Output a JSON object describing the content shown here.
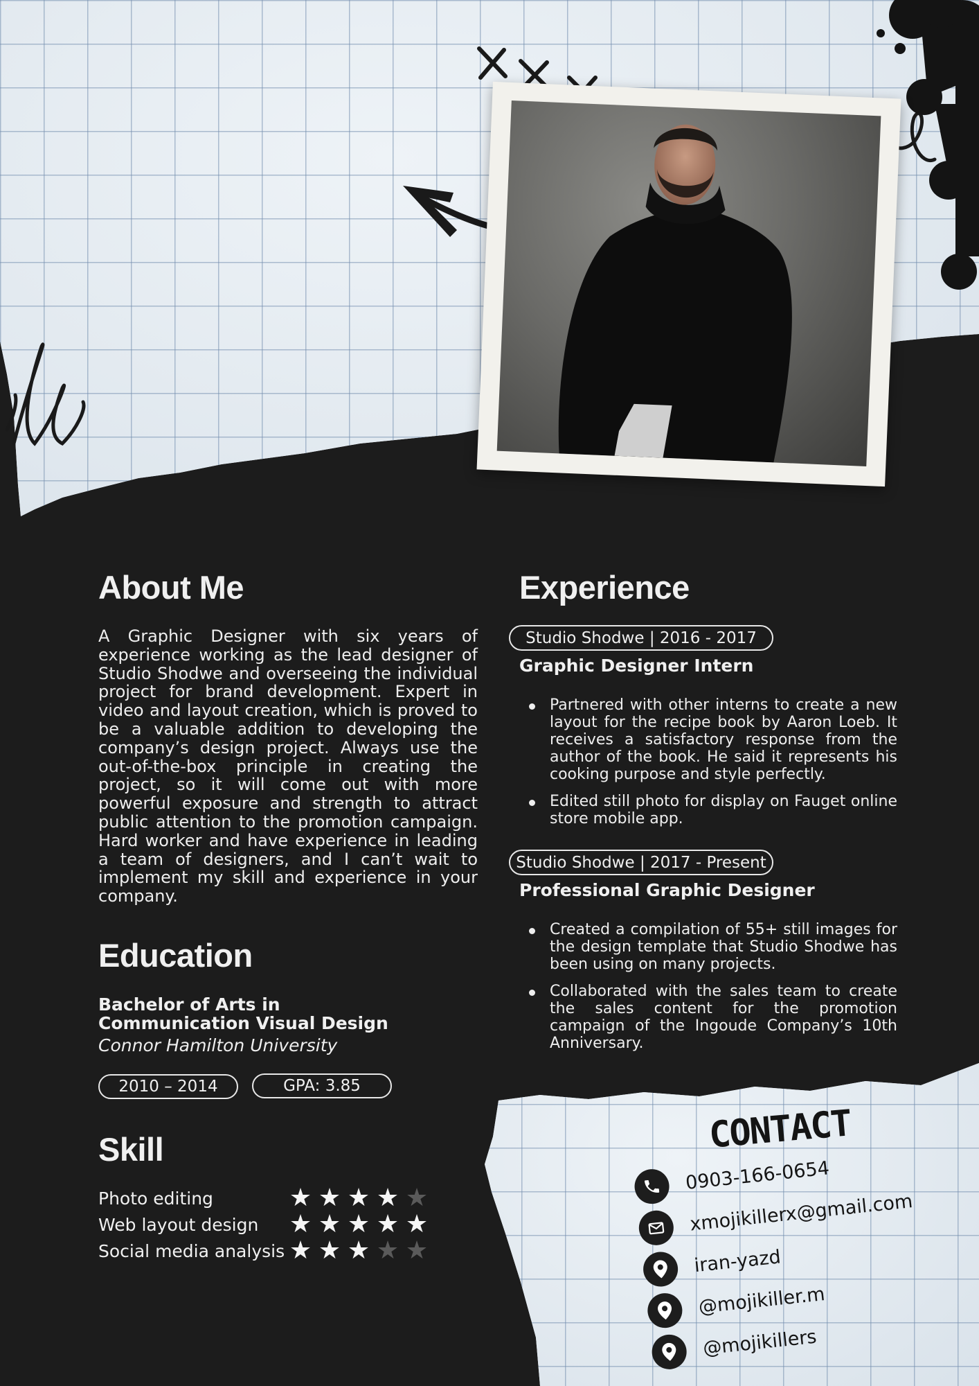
{
  "colors": {
    "background": "#1c1c1c",
    "paper": "#dfe7ee",
    "grid": "#748eae",
    "text_light": "#ededed",
    "text_dark": "#151515"
  },
  "about": {
    "heading": "About Me",
    "text": "A Graphic Designer with six years of experience working as the lead designer of Studio Shodwe and overseeing the individual project for brand development. Expert in video and layout creation, which is proved to be a valuable addition to developing the company’s design project. Always use the out-of-the-box principle in creating the project, so it will come out with more powerful exposure and strength to attract public attention to the promotion campaign. Hard worker and have experience in leading a team of designers, and I can’t wait to implement my skill and experience in your company."
  },
  "education": {
    "heading": "Education",
    "degree_line1": "Bachelor of Arts in",
    "degree_line2": "Communication Visual Design",
    "school": "Connor Hamilton University",
    "years": "2010 – 2014",
    "gpa": "GPA: 3.85"
  },
  "skills": {
    "heading": "Skill",
    "items": [
      {
        "name": "Photo editing",
        "rating": 4,
        "max": 5
      },
      {
        "name": "Web layout design",
        "rating": 5,
        "max": 5
      },
      {
        "name": "Social media analysis",
        "rating": 3,
        "max": 5
      }
    ]
  },
  "experience": {
    "heading": "Experience",
    "jobs": [
      {
        "period": "Studio Shodwe | 2016 - 2017",
        "title": "Graphic Designer Intern",
        "bullets": [
          "Partnered with other interns to create a new layout for the recipe book by Aaron Loeb. It receives a satisfactory response from the author of the book. He said it represents his cooking purpose and style perfectly.",
          "Edited still photo for display on Fauget online store mobile app."
        ]
      },
      {
        "period": "Studio Shodwe | 2017 - Present",
        "title": "Professional Graphic Designer",
        "bullets": [
          "Created a compilation of 55+ still images for the design template that Studio Shodwe has been using on many projects.",
          "Collaborated with the sales team to create the sales content for the promotion campaign of the Ingoude Company’s 10th Anniversary."
        ]
      }
    ]
  },
  "contact": {
    "heading": "CONTACT",
    "items": [
      {
        "icon": "phone-icon",
        "text": "0903-166-0654"
      },
      {
        "icon": "mail-icon",
        "text": "xmojikillerx@gmail.com"
      },
      {
        "icon": "location-pin-icon",
        "text": "iran-yazd"
      },
      {
        "icon": "location-pin-icon",
        "text": "@mojikiller.m"
      },
      {
        "icon": "location-pin-icon",
        "text": "@mojikillers"
      }
    ]
  }
}
